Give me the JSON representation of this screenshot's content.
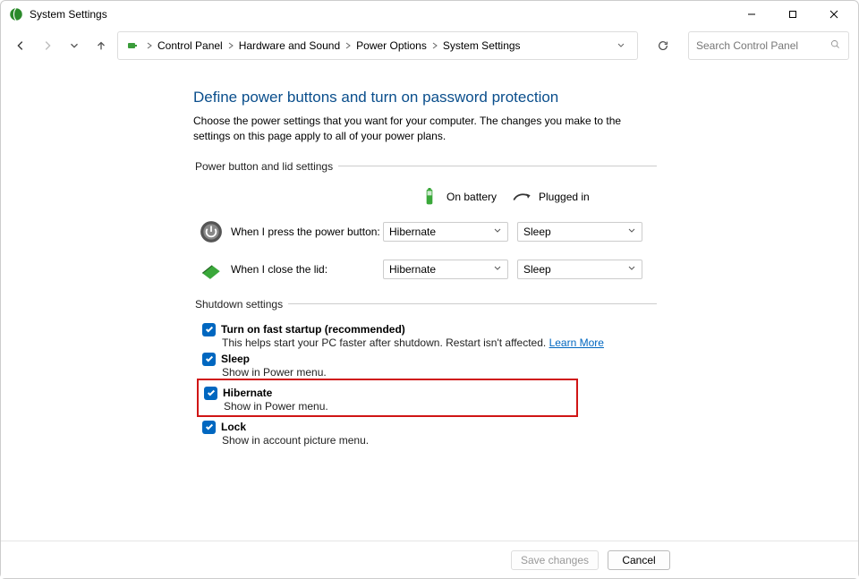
{
  "titlebar": {
    "title": "System Settings"
  },
  "breadcrumb": {
    "items": [
      "Control Panel",
      "Hardware and Sound",
      "Power Options",
      "System Settings"
    ]
  },
  "search": {
    "placeholder": "Search Control Panel"
  },
  "page": {
    "title": "Define power buttons and turn on password protection",
    "desc": "Choose the power settings that you want for your computer. The changes you make to the settings on this page apply to all of your power plans."
  },
  "section1": {
    "legend": "Power button and lid settings",
    "col_battery": "On battery",
    "col_plugged": "Plugged in",
    "row_power": {
      "label": "When I press the power button:",
      "battery": "Hibernate",
      "plugged": "Sleep"
    },
    "row_lid": {
      "label": "When I close the lid:",
      "battery": "Hibernate",
      "plugged": "Sleep"
    }
  },
  "section2": {
    "legend": "Shutdown settings",
    "fast": {
      "label": "Turn on fast startup (recommended)",
      "desc": "This helps start your PC faster after shutdown. Restart isn't affected. ",
      "more": "Learn More"
    },
    "sleep": {
      "label": "Sleep",
      "desc": "Show in Power menu."
    },
    "hiber": {
      "label": "Hibernate",
      "desc": "Show in Power menu."
    },
    "lock": {
      "label": "Lock",
      "desc": "Show in account picture menu."
    }
  },
  "buttons": {
    "save": "Save changes",
    "cancel": "Cancel"
  }
}
